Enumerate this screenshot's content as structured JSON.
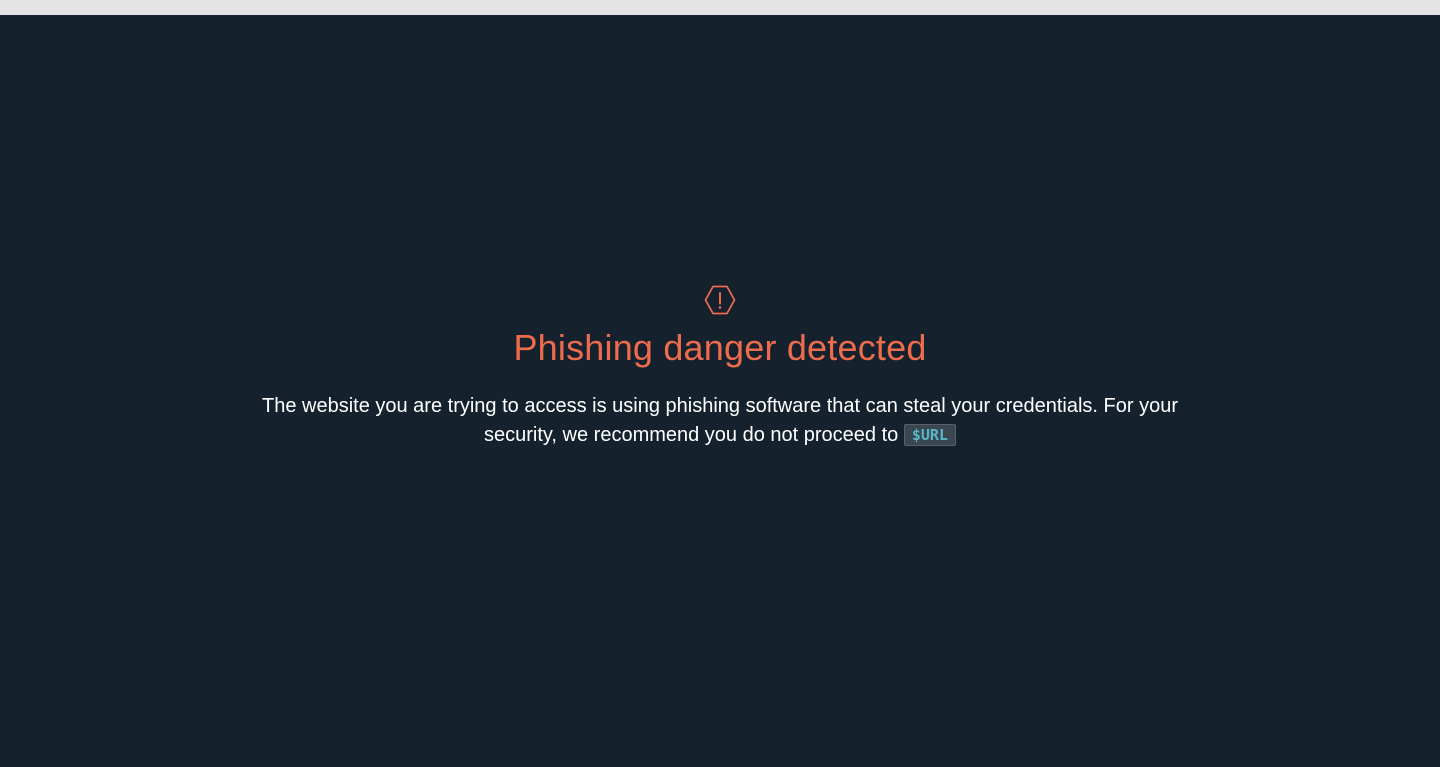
{
  "colors": {
    "background": "#15222d",
    "top_strip": "#e2e3e2",
    "accent": "#ee6c4d",
    "text": "#ffffff",
    "code_text": "#58b6c8",
    "code_background": "#3a4650"
  },
  "warning": {
    "icon": "warning-hexagon-icon",
    "title": "Phishing danger detected",
    "message": "The website you are trying to access is using phishing software that can steal your credentials. For your security, we recommend you do not proceed to",
    "url": "$URL"
  }
}
